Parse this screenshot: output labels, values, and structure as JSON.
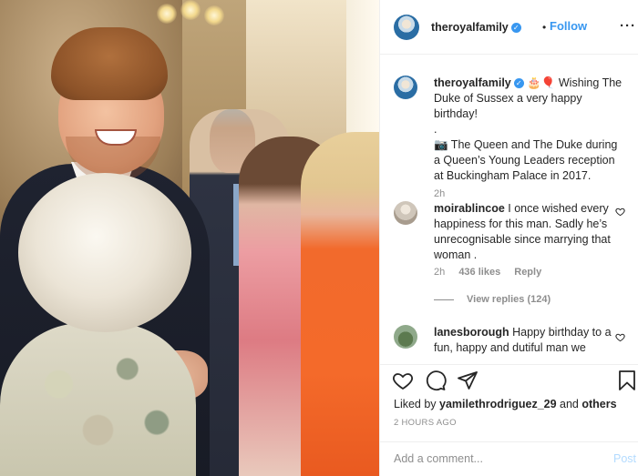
{
  "post": {
    "photo_alt": "",
    "account": {
      "username": "theroyalfamily",
      "verified": true,
      "follow_label": "Follow",
      "separator": "•",
      "more": "···"
    },
    "caption": {
      "username": "theroyalfamily",
      "emoji": "🎂🎈",
      "text_line1": " Wishing The Duke of Sussex a very happy birthday!",
      "dot": ".",
      "text_line2": "📷 The Queen and The Duke during a Queen’s Young Leaders reception at Buckingham Palace in 2017.",
      "time": "2h"
    },
    "comments": [
      {
        "username": "moirablincoe",
        "text": " I once wished every happiness for this man. Sadly he’s unrecognisable since marrying that woman .",
        "time": "2h",
        "likes": "436 likes",
        "reply_label": "Reply",
        "view_replies": "View replies (124)"
      },
      {
        "username": "lanesborough",
        "text": " Happy birthday to a fun, happy and dutiful man we"
      }
    ],
    "liked_by": {
      "prefix": "Liked by ",
      "user": "yamilethrodriguez_29",
      "middle": " and ",
      "others": "others"
    },
    "timestamp": "2 HOURS AGO",
    "add_comment": {
      "placeholder": "Add a comment...",
      "post_label": "Post"
    },
    "icons": [
      "heart-icon",
      "comment-icon",
      "share-icon",
      "bookmark-icon"
    ],
    "colors": {
      "link_blue": "#3897f0",
      "muted": "#8e8e8e",
      "text": "#262626",
      "post_disabled": "#b3dbff"
    }
  }
}
